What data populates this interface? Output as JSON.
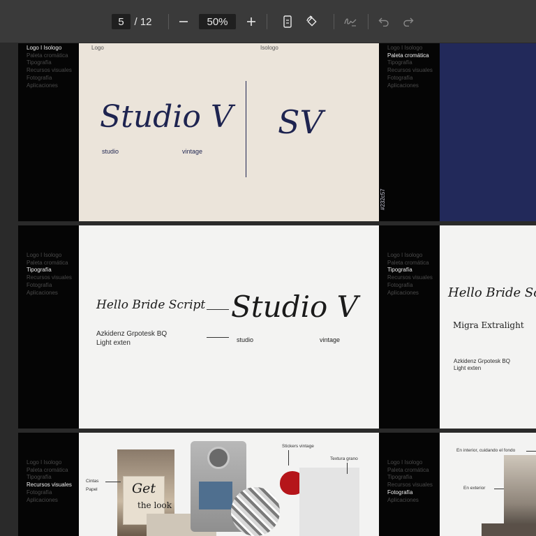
{
  "toolbar": {
    "current_page": "5",
    "total_pages": "/ 12",
    "zoom": "50%"
  },
  "nav_items": [
    "Logo I Isologo",
    "Paleta cromática",
    "Tipografía",
    "Recursos visuales",
    "Fotografía",
    "Aplicaciones"
  ],
  "slide_logo": {
    "label_logo": "Logo",
    "label_isologo": "Isologo",
    "wordmark": "Studio V",
    "sub_studio": "studio",
    "sub_vintage": "vintage",
    "monogram": "SV"
  },
  "slide_palette": {
    "hex": "#232c57"
  },
  "slide_typography": {
    "script_font": "Hello Bride Script",
    "sans_font_line1": "Azkidenz Grpotesk BQ",
    "sans_font_line2": "Light exten",
    "wordmark": "Studio V",
    "sub_studio": "studio",
    "sub_vintage": "vintage"
  },
  "slide_typography_b": {
    "script_font": "Hello Bride Script",
    "serif_font": "Migra Extralight",
    "sans_font_line1": "Azkidenz Grpotesk BQ",
    "sans_font_line2": "Light exten"
  },
  "slide_resources": {
    "ann_stickers": "Stickers vintage",
    "ann_texture": "Textura grano",
    "ann_tapes": "Cintas",
    "ann_paper": "Papel",
    "card_text_1": "Get",
    "card_text_2": "the look"
  },
  "slide_photo": {
    "ann_interior": "En interior, cuidando el fondo",
    "ann_exterior": "En exterior"
  },
  "colors": {
    "navy": "#232c57",
    "cream": "#ebe4da",
    "black": "#050505"
  }
}
